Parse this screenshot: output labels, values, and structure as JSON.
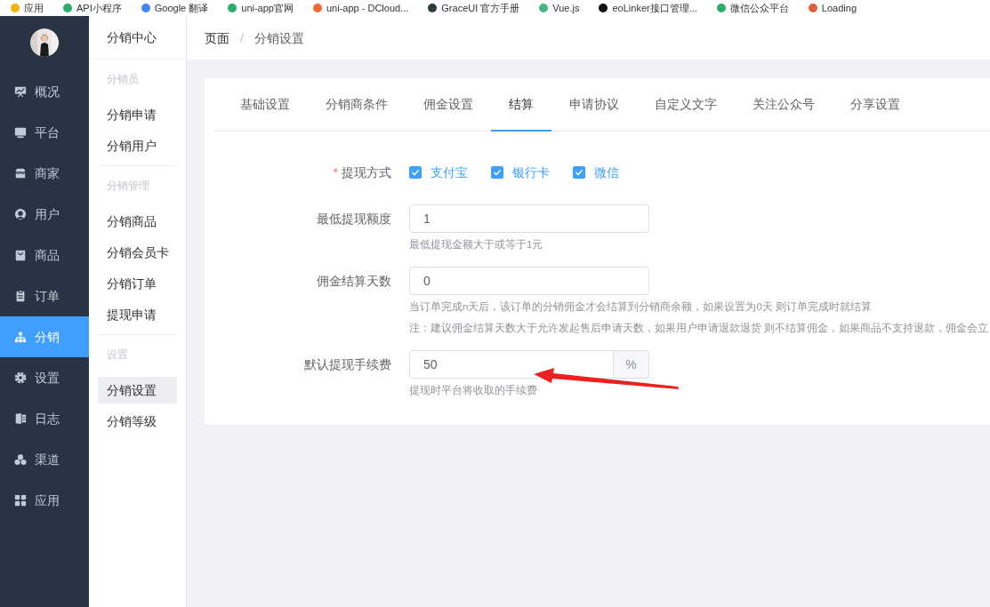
{
  "bookmarks": [
    {
      "label": "应用"
    },
    {
      "label": "API小程序"
    },
    {
      "label": "Google 翻译"
    },
    {
      "label": "uni-app官网"
    },
    {
      "label": "uni-app - DCloud..."
    },
    {
      "label": "GraceUI 官方手册"
    },
    {
      "label": "Vue.js"
    },
    {
      "label": "eoLinker接口管理..."
    },
    {
      "label": "微信公众平台"
    },
    {
      "label": "Loading"
    }
  ],
  "sidebar": {
    "items": [
      {
        "label": "概况",
        "selected": false
      },
      {
        "label": "平台",
        "selected": false
      },
      {
        "label": "商家",
        "selected": false
      },
      {
        "label": "用户",
        "selected": false
      },
      {
        "label": "商品",
        "selected": false
      },
      {
        "label": "订单",
        "selected": false
      },
      {
        "label": "分销",
        "selected": true
      },
      {
        "label": "设置",
        "selected": false
      },
      {
        "label": "日志",
        "selected": false
      },
      {
        "label": "渠道",
        "selected": false
      },
      {
        "label": "应用",
        "selected": false
      }
    ]
  },
  "submenu": {
    "title": "分销中心",
    "groups": [
      {
        "title": "分销员",
        "items": [
          {
            "label": "分销申请",
            "selected": false
          },
          {
            "label": "分销用户",
            "selected": false
          }
        ]
      },
      {
        "title": "分销管理",
        "items": [
          {
            "label": "分销商品",
            "selected": false
          },
          {
            "label": "分销会员卡",
            "selected": false
          },
          {
            "label": "分销订单",
            "selected": false
          },
          {
            "label": "提现申请",
            "selected": false
          }
        ]
      },
      {
        "title": "设置",
        "items": [
          {
            "label": "分销设置",
            "selected": true
          },
          {
            "label": "分销等级",
            "selected": false
          }
        ]
      }
    ]
  },
  "breadcrumb": {
    "separator": "/",
    "items": [
      "页面",
      "分销设置"
    ]
  },
  "tabs": [
    {
      "label": "基础设置",
      "selected": false
    },
    {
      "label": "分销商条件",
      "selected": false
    },
    {
      "label": "佣金设置",
      "selected": false
    },
    {
      "label": "结算",
      "selected": true
    },
    {
      "label": "申请协议",
      "selected": false
    },
    {
      "label": "自定义文字",
      "selected": false
    },
    {
      "label": "关注公众号",
      "selected": false
    },
    {
      "label": "分享设置",
      "selected": false
    }
  ],
  "form": [
    {
      "kind": "checkboxes",
      "label": "提现方式",
      "required_mark": "*",
      "options": [
        {
          "label": "支付宝",
          "checked": true
        },
        {
          "label": "银行卡",
          "checked": true
        },
        {
          "label": "微信",
          "checked": true
        }
      ]
    },
    {
      "kind": "input",
      "label": "最低提现额度",
      "value": "1",
      "help": [
        "最低提现金额大于或等于1元"
      ]
    },
    {
      "kind": "input",
      "label": "佣金结算天数",
      "value": "0",
      "help": [
        "当订单完成n天后，该订单的分销佣金才会结算到分销商余额，如果设置为0天 则订单完成时就结算",
        "注：建议佣金结算天数大于允许发起售后申请天数，如果用户申请退款退货 则不结算佣金，如果商品不支持退款，佣金会立"
      ]
    },
    {
      "kind": "suffix",
      "label": "默认提现手续费",
      "value": "50",
      "suffix": "%",
      "help": [
        "提现时平台将收取的手续费"
      ]
    }
  ]
}
